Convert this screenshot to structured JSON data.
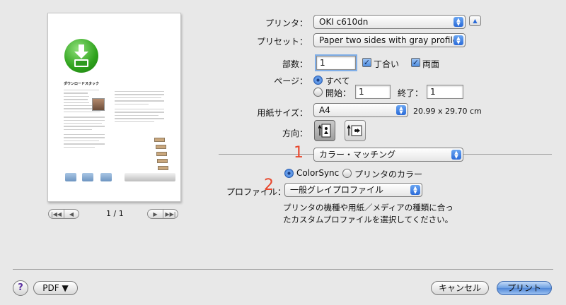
{
  "preview": {
    "doc_title": "ダウンロードスタック",
    "page_counter": "1 / 1",
    "nav": {
      "first": "|◀◀",
      "prev": "◀",
      "next": "▶",
      "last": "▶▶|"
    }
  },
  "printer": {
    "label": "プリンタ：",
    "value": "OKI c610dn",
    "disclosure": "▲"
  },
  "preset": {
    "label": "プリセット：",
    "value": "Paper two sides with gray profile"
  },
  "copies": {
    "label": "部数：",
    "value": "1",
    "collated_label": "丁合い",
    "collated_checked": true,
    "two_sided_label": "両面",
    "two_sided_checked": true
  },
  "pages": {
    "label": "ページ：",
    "all_label": "すべて",
    "from_label": "開始：",
    "from_value": "1",
    "to_label": "終了：",
    "to_value": "1"
  },
  "paper_size": {
    "label": "用紙サイズ：",
    "value": "A4",
    "dims": "20.99 x 29.70 cm"
  },
  "orientation": {
    "label": "方向：",
    "selected": "portrait"
  },
  "section": {
    "marker": "1",
    "value": "カラー・マッチング"
  },
  "color": {
    "colorsync_label": "ColorSync",
    "printer_color_label": "プリンタのカラー",
    "profile_marker": "2",
    "profile_label": "プロファイル：",
    "profile_value": "一般グレイプロファイル",
    "description_line1": "プリンタの機種や用紙／メディアの種類に合っ",
    "description_line2": "たカスタムプロファイルを選択してください。"
  },
  "footer": {
    "help": "?",
    "pdf": "PDF ▼",
    "cancel": "キャンセル",
    "print": "プリント"
  },
  "colors": {
    "accent": "#3b7ad8",
    "marker": "#e8472c",
    "background": "#e8e8e8"
  }
}
